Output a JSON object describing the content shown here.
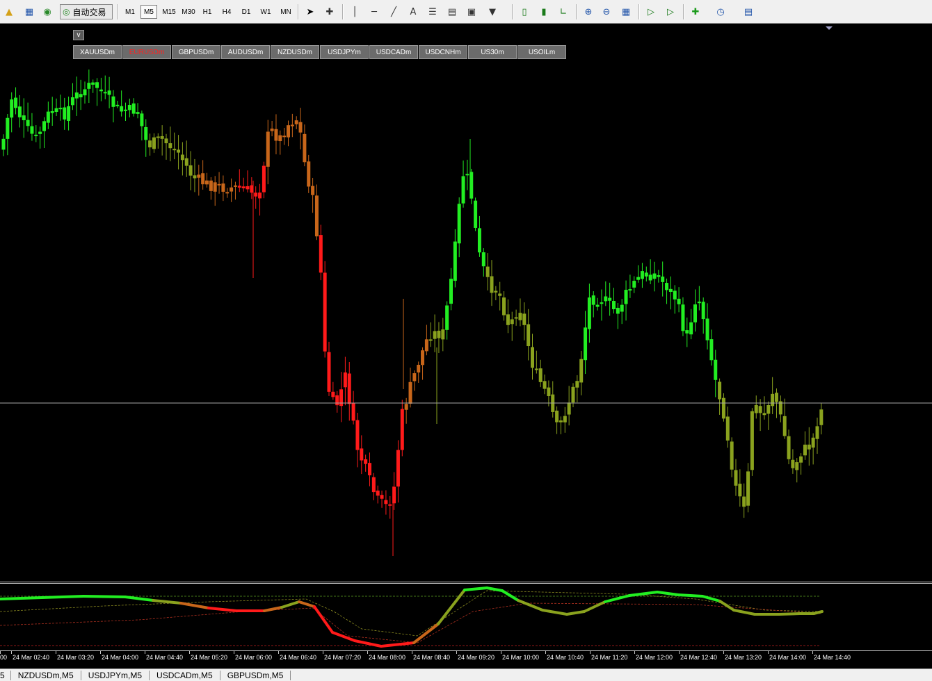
{
  "toolbar": {
    "auto_trading_label": "自动交易",
    "timeframes": [
      "M1",
      "M5",
      "M15",
      "M30",
      "H1",
      "H4",
      "D1",
      "W1",
      "MN"
    ],
    "active_timeframe": "M5"
  },
  "chart": {
    "collapse_label": "v",
    "symbol_buttons": [
      "XAUUSDm",
      "EURUSDm",
      "GBPUSDm",
      "AUDUSDm",
      "NZDUSDm",
      "USDJPYm",
      "USDCADm",
      "USDCNHm",
      "US30m",
      "USOILm"
    ],
    "active_symbol": "EURUSDm",
    "colors": {
      "bull_strong": "#22ee22",
      "mid": "#8aa21e",
      "orange": "#c8661a",
      "bear": "#ff1a1a"
    }
  },
  "time_axis": {
    "labels": [
      "00",
      "24 Mar 02:40",
      "24 Mar 03:20",
      "24 Mar 04:00",
      "24 Mar 04:40",
      "24 Mar 05:20",
      "24 Mar 06:00",
      "24 Mar 06:40",
      "24 Mar 07:20",
      "24 Mar 08:00",
      "24 Mar 08:40",
      "24 Mar 09:20",
      "24 Mar 10:00",
      "24 Mar 10:40",
      "24 Mar 11:20",
      "24 Mar 12:00",
      "24 Mar 12:40",
      "24 Mar 13:20",
      "24 Mar 14:00",
      "24 Mar 14:40"
    ]
  },
  "tabs": [
    "5",
    "NZDUSDm,M5",
    "USDJPYm,M5",
    "USDCADm,M5",
    "GBPUSDm,M5"
  ]
}
